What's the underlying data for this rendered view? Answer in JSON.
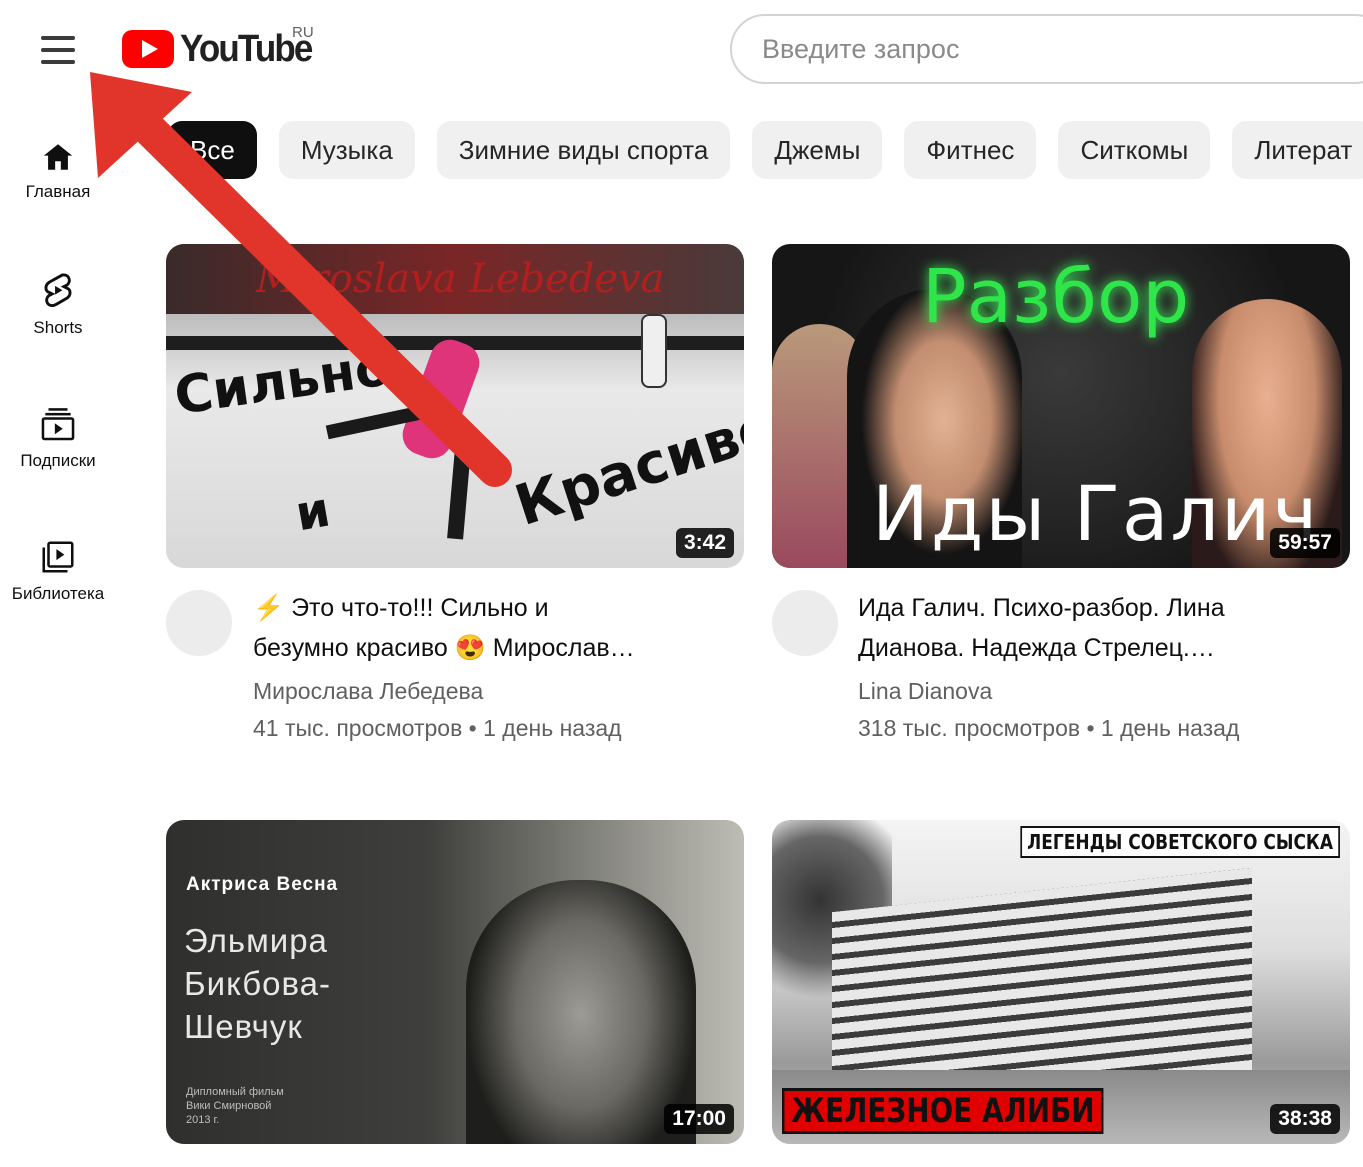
{
  "header": {
    "logo_text": "YouTube",
    "region": "RU",
    "search_placeholder": "Введите запрос"
  },
  "sidebar": {
    "items": [
      {
        "label": "Главная",
        "icon": "home-icon"
      },
      {
        "label": "Shorts",
        "icon": "shorts-icon"
      },
      {
        "label": "Подписки",
        "icon": "subscriptions-icon"
      },
      {
        "label": "Библиотека",
        "icon": "library-icon"
      }
    ]
  },
  "chips": [
    "Все",
    "Музыка",
    "Зимние виды спорта",
    "Джемы",
    "Фитнес",
    "Ситкомы",
    "Литерат"
  ],
  "videos": [
    {
      "thumb_texts": [
        "Сильно",
        "и",
        "Красиво"
      ],
      "thumb_banner": "Miroslava Lebedeva",
      "duration": "3:42",
      "title_line1": "⚡ Это что-то!!! Сильно и",
      "title_line2": "безумно красиво 😍 Мирослав…",
      "channel": "Мирослава Лебедева",
      "meta": "41 тыс. просмотров • 1 день назад"
    },
    {
      "thumb_texts": [
        "Разбор",
        "Иды Галич"
      ],
      "duration": "59:57",
      "title_line1": "Ида Галич. Психо-разбор. Лина",
      "title_line2": "Дианова. Надежда Стрелец.…",
      "channel": "Lina Dianova",
      "meta": "318 тыс. просмотров • 1 день назад"
    },
    {
      "thumb_texts": [
        "Актриса Весна",
        "Эльмира",
        "Бикбова-",
        "Шевчук",
        "Дипломный фильм",
        "Вики Смирновой",
        "2013 г."
      ],
      "duration": "17:00"
    },
    {
      "thumb_texts": [
        "ЛЕГЕНДЫ СОВЕТСКОГО СЫСКА",
        "ЖЕЛЕЗНОЕ АЛИБИ"
      ],
      "duration": "38:38"
    }
  ],
  "colors": {
    "brand_red": "#ff0000",
    "arrow_red": "#e1352b",
    "chip_bg": "#f0f0f0",
    "chip_active_bg": "#0f0f0f"
  }
}
